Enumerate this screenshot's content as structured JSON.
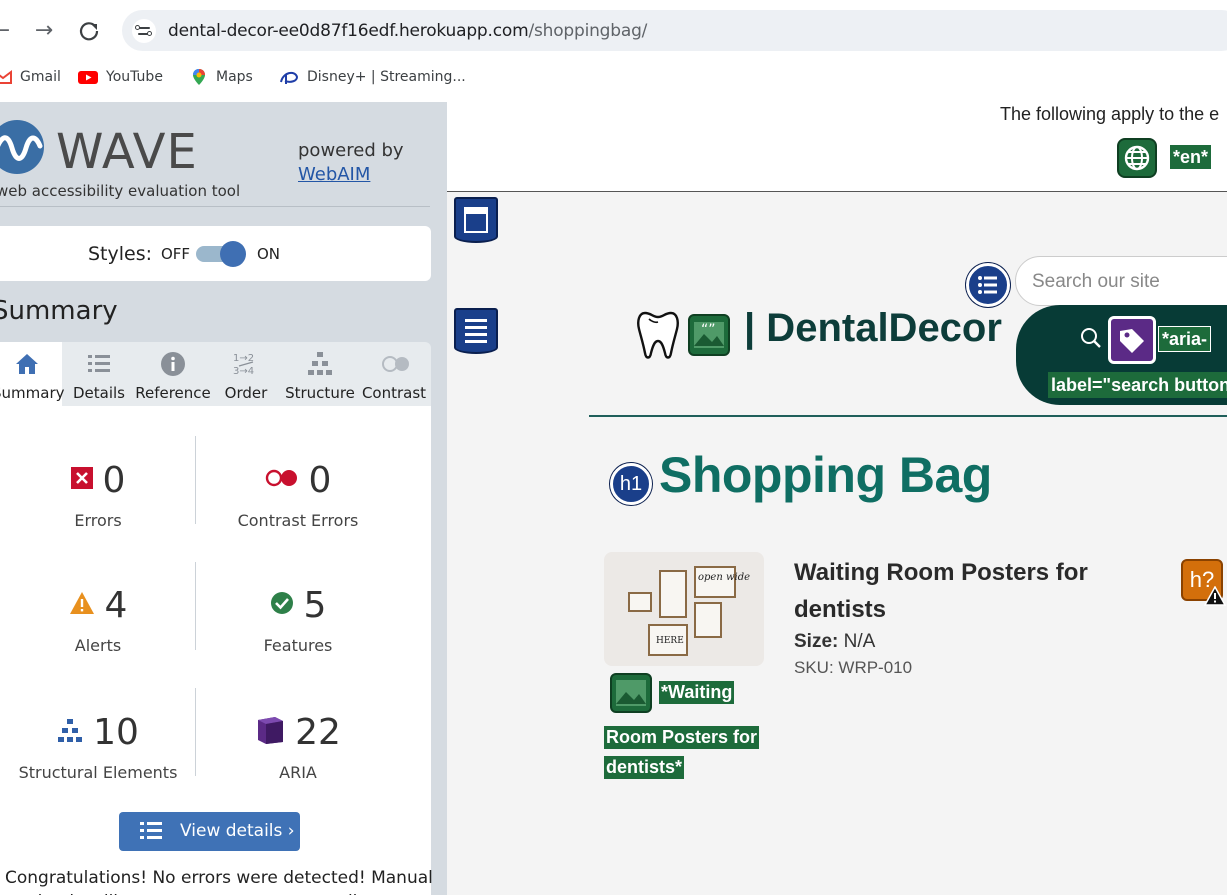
{
  "browser": {
    "url_host": "dental-decor-ee0d87f16edf.herokuapp.com",
    "url_path": "/shoppingbag/",
    "bookmarks": [
      {
        "label": "Gmail",
        "icon": "gmail-icon"
      },
      {
        "label": "YouTube",
        "icon": "youtube-icon"
      },
      {
        "label": "Maps",
        "icon": "maps-icon"
      },
      {
        "label": "Disney+ | Streaming...",
        "icon": "disney-icon"
      }
    ]
  },
  "wave": {
    "title": "WAVE",
    "tagline": "web accessibility evaluation tool",
    "powered_by": "powered by",
    "webaim_link": "WebAIM",
    "styles_label": "Styles:",
    "styles_off": "OFF",
    "styles_on": "ON",
    "summary_heading": "Summary",
    "tabs": [
      {
        "label": "Summary",
        "icon": "home-icon"
      },
      {
        "label": "Details",
        "icon": "list-icon"
      },
      {
        "label": "Reference",
        "icon": "info-icon"
      },
      {
        "label": "Order",
        "icon": "order-icon"
      },
      {
        "label": "Structure",
        "icon": "structure-icon"
      },
      {
        "label": "Contrast",
        "icon": "contrast-icon"
      }
    ],
    "stats": {
      "errors": {
        "value": "0",
        "label": "Errors"
      },
      "contrast_errors": {
        "value": "0",
        "label": "Contrast Errors"
      },
      "alerts": {
        "value": "4",
        "label": "Alerts"
      },
      "features": {
        "value": "5",
        "label": "Features"
      },
      "structural": {
        "value": "10",
        "label": "Structural Elements"
      },
      "aria": {
        "value": "22",
        "label": "ARIA"
      }
    },
    "view_details": "View details ›",
    "congrats": "Congratulations! No errors were detected! Manual testing is still necessary to ensure compliance and"
  },
  "site": {
    "lang_note": "The following apply to the e",
    "lang_tag": "*en*",
    "search_placeholder": "Search our site",
    "aria_label_tag_1": "*aria-",
    "aria_label_tag_2": "label=\"search button\"",
    "brand": "| DentalDecor",
    "h1_badge": "h1",
    "page_title": "Shopping Bag",
    "product": {
      "name": "Waiting Room Posters for dentists",
      "size_label": "Size:",
      "size_value": "N/A",
      "sku": "SKU: WRP-010",
      "alt_line1": "*Waiting",
      "alt_line2": "Room Posters for",
      "alt_line3": "dentists*",
      "img_text_1": "open wide",
      "img_text_2": "HERE"
    },
    "h_alert": "h?"
  },
  "colors": {
    "wave_panel": "#d5dbe1",
    "wave_button": "#3f72b6",
    "site_teal": "#0f6e63",
    "wave_green": "#1d6b3b",
    "landmark_blue": "#1a3f8a"
  }
}
